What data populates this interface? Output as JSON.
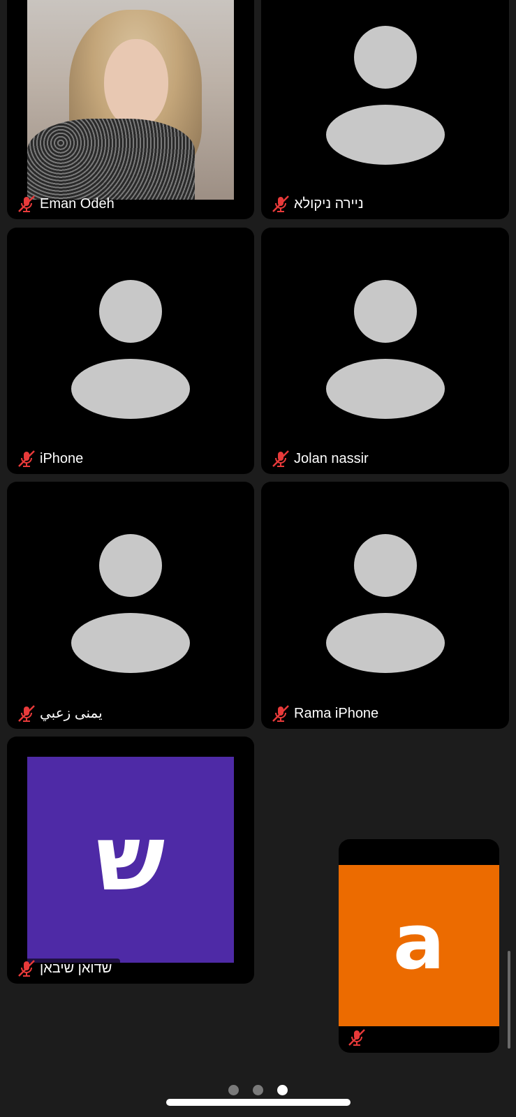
{
  "participants": [
    {
      "name": "Eman Odeh",
      "muted": true,
      "video": "photo"
    },
    {
      "name": "ניירה ניקולא",
      "muted": true,
      "video": "avatar"
    },
    {
      "name": "iPhone",
      "muted": true,
      "video": "avatar"
    },
    {
      "name": "Jolan nassir",
      "muted": true,
      "video": "avatar"
    },
    {
      "name": "يمنى زعبي",
      "muted": true,
      "video": "avatar"
    },
    {
      "name": "Rama iPhone",
      "muted": true,
      "video": "avatar"
    },
    {
      "name": "שדואן שיבאן",
      "muted": true,
      "video": "initial",
      "initial": "ש",
      "color": "#4e2aa6"
    }
  ],
  "self_view": {
    "initial": "a",
    "color": "#ec6b00",
    "muted": true
  },
  "pagination": {
    "pages": 3,
    "current": 3
  },
  "icons": {
    "mute": "mic-off-icon"
  },
  "colors": {
    "mute": "#e83a3a",
    "background": "#1c1c1c",
    "avatar": "#c8c8c8"
  }
}
